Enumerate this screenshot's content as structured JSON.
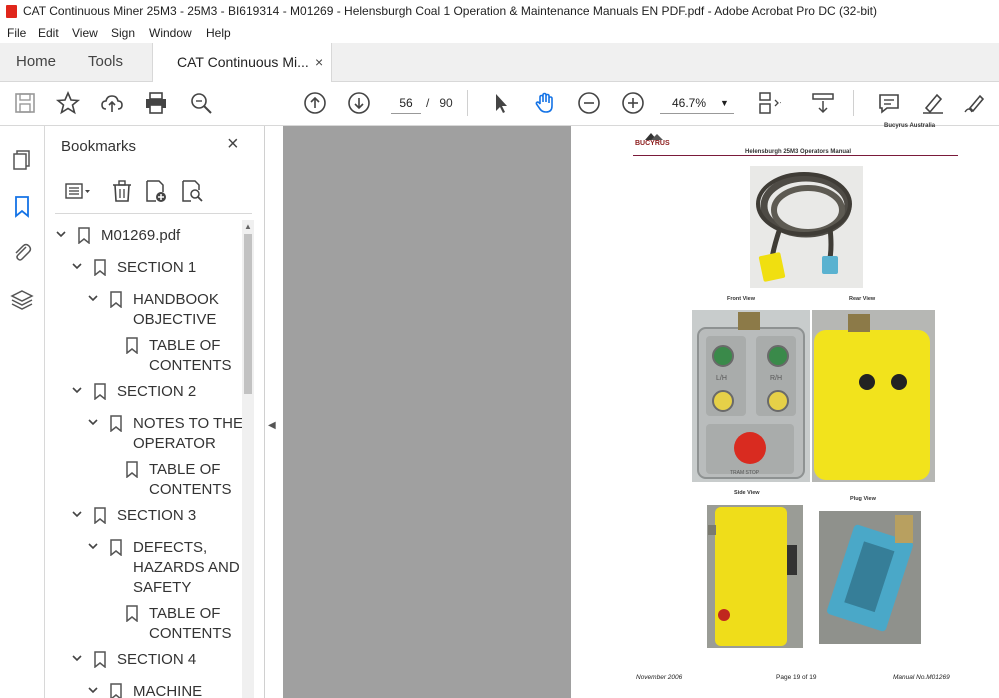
{
  "window": {
    "title": "CAT Continuous Miner 25M3 - 25M3 - BI619314 - M01269 - Helensburgh Coal 1 Operation & Maintenance Manuals EN PDF.pdf - Adobe Acrobat Pro DC (32-bit)"
  },
  "menu": [
    "File",
    "Edit",
    "View",
    "Sign",
    "Window",
    "Help"
  ],
  "tabs": {
    "home": "Home",
    "tools": "Tools",
    "document": "CAT Continuous Mi...",
    "close": "×"
  },
  "toolbar": {
    "page_current": "56",
    "page_separator": "/",
    "page_total": "90",
    "zoom": "46.7%"
  },
  "bookmarks": {
    "title": "Bookmarks",
    "close": "×",
    "items": [
      {
        "label": "M01269.pdf"
      },
      {
        "label": "SECTION 1"
      },
      {
        "label": "HANDBOOK",
        "label2": "OBJECTIVE"
      },
      {
        "label": "TABLE OF",
        "label2": "CONTENTS"
      },
      {
        "label": "SECTION 2"
      },
      {
        "label": "NOTES TO THE",
        "label2": "OPERATOR"
      },
      {
        "label": "TABLE OF",
        "label2": "CONTENTS"
      },
      {
        "label": "SECTION 3"
      },
      {
        "label": "DEFECTS,",
        "label2": "HAZARDS AND",
        "label3": "SAFETY"
      },
      {
        "label": "TABLE OF",
        "label2": "CONTENTS"
      },
      {
        "label": "SECTION 4"
      },
      {
        "label": "MACHINE"
      }
    ]
  },
  "document_page": {
    "header_right": "Bucyrus Australia",
    "logo_text": "BUCYRUS",
    "manual_title": "Helensburgh 25M3 Operators Manual",
    "captions": {
      "front": "Front View",
      "rear": "Rear View",
      "side": "Side View",
      "plug": "Plug View"
    },
    "panel_labels": {
      "lh": "L/H",
      "rh": "R/H",
      "stop": "TRAM STOP"
    },
    "footer": {
      "date": "November 2006",
      "page": "Page 19 of 19",
      "manual_no": "Manual No.M01269"
    }
  },
  "colors": {
    "accent_blue": "#1473e6",
    "viewer_bg": "#a0a0a0",
    "pendant_yellow": "#f2e31c",
    "plug_blue": "#4aa8c8"
  }
}
